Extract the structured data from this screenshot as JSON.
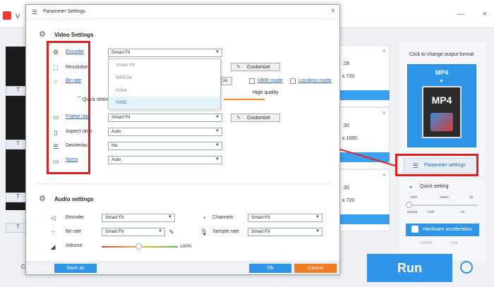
{
  "app": {
    "title_initial": "V",
    "window_controls": [
      "—",
      "×"
    ],
    "left_labels": [
      "T",
      "T",
      "T",
      "T"
    ],
    "cards": [
      {
        "v1": ":28",
        "v2": "x 720"
      },
      {
        "v1": ":30",
        "v2": "x 1080"
      },
      {
        "v1": ":30",
        "v2": "x 720"
      }
    ],
    "right_panel_title": "Click to change output format:",
    "format": "MP4",
    "format_icon_label": "MP4",
    "parameter_settings": "Parameter settings",
    "quick_setting": "Quick setting",
    "qs_ticks_top": [
      "480P",
      "1080P",
      "4K"
    ],
    "qs_ticks_bottom": [
      "Default",
      "720P",
      "2K"
    ],
    "hardware_acceleration": "Hardware acceleration",
    "gpu_labels": [
      "NVIDIA",
      "Intel"
    ],
    "run": "Run",
    "bottom_left_char": "C"
  },
  "dialog": {
    "title": "Parameter Settings",
    "close": "×",
    "video_section": "Video Settings",
    "audio_section": "Audio settings",
    "video_rows": [
      {
        "label": "Encoder",
        "link": true,
        "icon": "gear-icon"
      },
      {
        "label": "Resolution",
        "link": false,
        "icon": "resize-icon"
      },
      {
        "label": "Bit rate",
        "link": true,
        "icon": "dots-icon"
      },
      {
        "label": "Frame rate",
        "link": true,
        "icon": "film-icon"
      },
      {
        "label": "Aspect ratio",
        "link": false,
        "icon": "aspect-icon"
      },
      {
        "label": "Deinterlace",
        "link": false,
        "icon": "lines-icon"
      },
      {
        "label": "Norm",
        "link": true,
        "icon": "monitor-icon"
      }
    ],
    "encoder_value": "Smart Fit",
    "encoder_options": [
      "Smart Fit",
      "MPEG4",
      "H264",
      "H265"
    ],
    "encoder_selected": "H265",
    "resolution_partial": "ze",
    "frame_rate_value": "Smart Fit",
    "aspect_ratio_value": "Auto",
    "deinterlace_value": "No",
    "norm_value": "Auto",
    "customize": "Customize",
    "vbir_mode": "VBIR mode",
    "lossless_mode": "Lossless mode",
    "quick_setting_text": "Quick setting",
    "high_quality": "High quality",
    "audio": {
      "encoder_label": "Encoder",
      "encoder_value": "Smart Fit",
      "bitrate_label": "Bit rate",
      "bitrate_value": "Smart Fit",
      "channels_label": "Channels",
      "channels_value": "Smart Fit",
      "sample_rate_label": "Sample rate",
      "sample_rate_value": "Smart Fit",
      "volume_label": "Volume",
      "volume_pct": "100%"
    },
    "save_as": "Save as",
    "ok": "Ok",
    "cancel": "Cancel"
  },
  "colors": {
    "accent": "#2f95e8",
    "highlight": "#e02020",
    "cancel": "#f07b20"
  }
}
